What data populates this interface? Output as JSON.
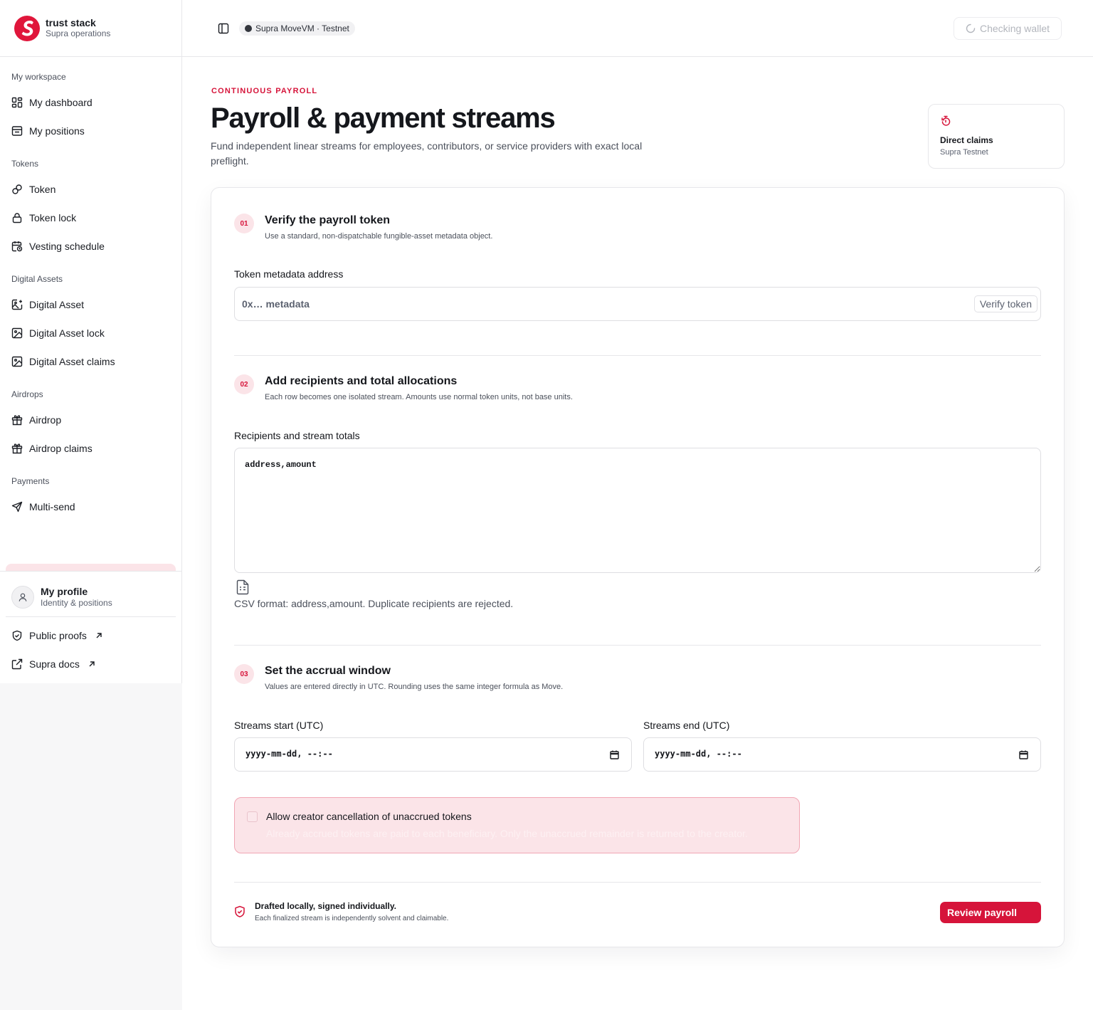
{
  "brand": {
    "title": "trust stack",
    "subtitle": "Supra operations"
  },
  "sidebar": {
    "sections": [
      {
        "heading": "My workspace",
        "items": [
          {
            "label": "My dashboard",
            "icon": "dashboard-icon"
          },
          {
            "label": "My positions",
            "icon": "positions-icon"
          }
        ]
      },
      {
        "heading": "Tokens",
        "items": [
          {
            "label": "Token",
            "icon": "link-icon"
          },
          {
            "label": "Token lock",
            "icon": "lock-icon"
          },
          {
            "label": "Vesting schedule",
            "icon": "calendar-clock-icon"
          }
        ]
      },
      {
        "heading": "Digital Assets",
        "items": [
          {
            "label": "Digital Asset",
            "icon": "image-plus-icon"
          },
          {
            "label": "Digital Asset lock",
            "icon": "image-icon"
          },
          {
            "label": "Digital Asset claims",
            "icon": "image-icon"
          }
        ]
      },
      {
        "heading": "Airdrops",
        "items": [
          {
            "label": "Airdrop",
            "icon": "gift-icon"
          },
          {
            "label": "Airdrop claims",
            "icon": "gift-icon"
          }
        ]
      },
      {
        "heading": "Payments",
        "items": [
          {
            "label": "Multi-send",
            "icon": "send-icon"
          }
        ]
      }
    ],
    "profile": {
      "name": "My profile",
      "subtitle": "Identity & positions"
    },
    "links": [
      {
        "label": "Public proofs",
        "icon": "shield-check-icon"
      },
      {
        "label": "Supra docs",
        "icon": "external-link-icon"
      }
    ]
  },
  "topbar": {
    "network": "Supra MoveVM · Testnet",
    "wallet_status": "Checking wallet"
  },
  "page": {
    "eyebrow": "CONTINUOUS PAYROLL",
    "title": "Payroll & payment streams",
    "description": "Fund independent linear streams for employees, contributors, or service providers with exact local preflight."
  },
  "claims_card": {
    "title": "Direct claims",
    "subtitle": "Supra Testnet"
  },
  "steps": {
    "s1": {
      "number": "01",
      "title": "Verify the payroll token",
      "description": "Use a standard, non-dispatchable fungible-asset metadata object.",
      "field_label": "Token metadata address",
      "placeholder": "0x… metadata",
      "button": "Verify token"
    },
    "s2": {
      "number": "02",
      "title": "Add recipients and total allocations",
      "description": "Each row becomes one isolated stream. Amounts use normal token units, not base units.",
      "field_label": "Recipients and stream totals",
      "value": "address,amount",
      "hint": "CSV format: address,amount. Duplicate recipients are rejected."
    },
    "s3": {
      "number": "03",
      "title": "Set the accrual window",
      "description": "Values are entered directly in UTC. Rounding uses the same integer formula as Move.",
      "start_label": "Streams start (UTC)",
      "start_value": "yyyy-mm-dd, --:--",
      "end_label": "Streams end (UTC)",
      "end_value": "yyyy-mm-dd, --:--"
    }
  },
  "cancellation": {
    "label": "Allow creator cancellation of unaccrued tokens",
    "description": "Already accrued tokens are paid to each beneficiary. Only the unaccrued remainder is returned to the creator.",
    "checked": false
  },
  "footer": {
    "title": "Drafted locally, signed individually.",
    "description": "Each finalized stream is independently solvent and claimable.",
    "button": "Review payroll"
  },
  "colors": {
    "accent": "#d6143a",
    "accent_soft": "#fbe4e8"
  }
}
